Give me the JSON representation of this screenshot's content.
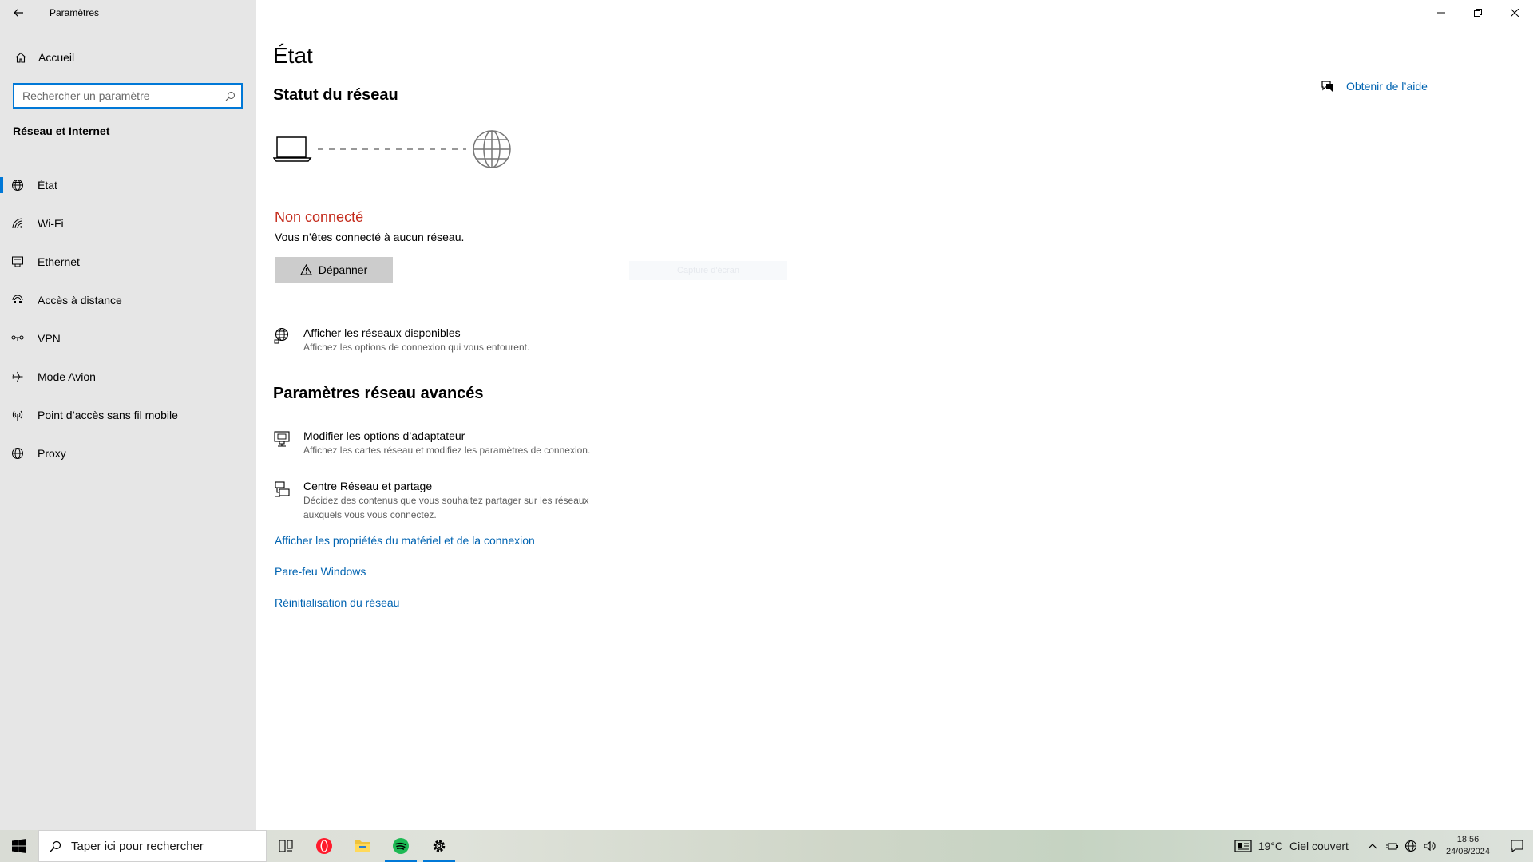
{
  "window": {
    "title": "Paramètres",
    "controls": [
      "minimize-icon",
      "restore-icon",
      "close-icon"
    ]
  },
  "sidebar": {
    "home_label": "Accueil",
    "search_placeholder": "Rechercher un paramètre",
    "search_value": "",
    "section_title": "Réseau et Internet",
    "items": [
      {
        "label": "État",
        "icon": "status-globe-icon",
        "active": true
      },
      {
        "label": "Wi-Fi",
        "icon": "wifi-icon",
        "active": false
      },
      {
        "label": "Ethernet",
        "icon": "ethernet-icon",
        "active": false
      },
      {
        "label": "Accès à distance",
        "icon": "dialup-icon",
        "active": false
      },
      {
        "label": "VPN",
        "icon": "vpn-icon",
        "active": false
      },
      {
        "label": "Mode Avion",
        "icon": "airplane-icon",
        "active": false
      },
      {
        "label": "Point d’accès sans fil mobile",
        "icon": "hotspot-icon",
        "active": false
      },
      {
        "label": "Proxy",
        "icon": "globe-icon",
        "active": false
      }
    ]
  },
  "main": {
    "title": "État",
    "network_status_title": "Statut du réseau",
    "status": {
      "title": "Non connecté",
      "description": "Vous n’êtes connecté à aucun réseau.",
      "color": "#c42b1c"
    },
    "troubleshoot_label": "Dépanner",
    "ghost_button_label": "Capture d'écran",
    "available_networks": {
      "title": "Afficher les réseaux disponibles",
      "description": "Affichez les options de connexion qui vous entourent."
    },
    "advanced_title": "Paramètres réseau avancés",
    "adapter_options": {
      "title": "Modifier les options d’adaptateur",
      "description": "Affichez les cartes réseau et modifiez les paramètres de connexion."
    },
    "sharing_center": {
      "title": "Centre Réseau et partage",
      "description": "Décidez des contenus que vous souhaitez partager sur les réseaux auxquels vous vous connectez."
    },
    "links": {
      "hardware_properties": "Afficher les propriétés du matériel et de la connexion",
      "firewall": "Pare-feu Windows",
      "network_reset": "Réinitialisation du réseau"
    },
    "help_label": "Obtenir de l’aide",
    "accent_color": "#0078d7",
    "link_color": "#0063b1"
  },
  "taskbar": {
    "search_placeholder": "Taper ici pour rechercher",
    "apps": [
      "task-view-icon",
      "opera-icon",
      "file-explorer-icon",
      "spotify-icon",
      "settings-icon"
    ],
    "weather": {
      "temperature": "19°C",
      "condition": "Ciel couvert"
    },
    "clock": {
      "time": "18:56",
      "date": "24/08/2024"
    }
  }
}
